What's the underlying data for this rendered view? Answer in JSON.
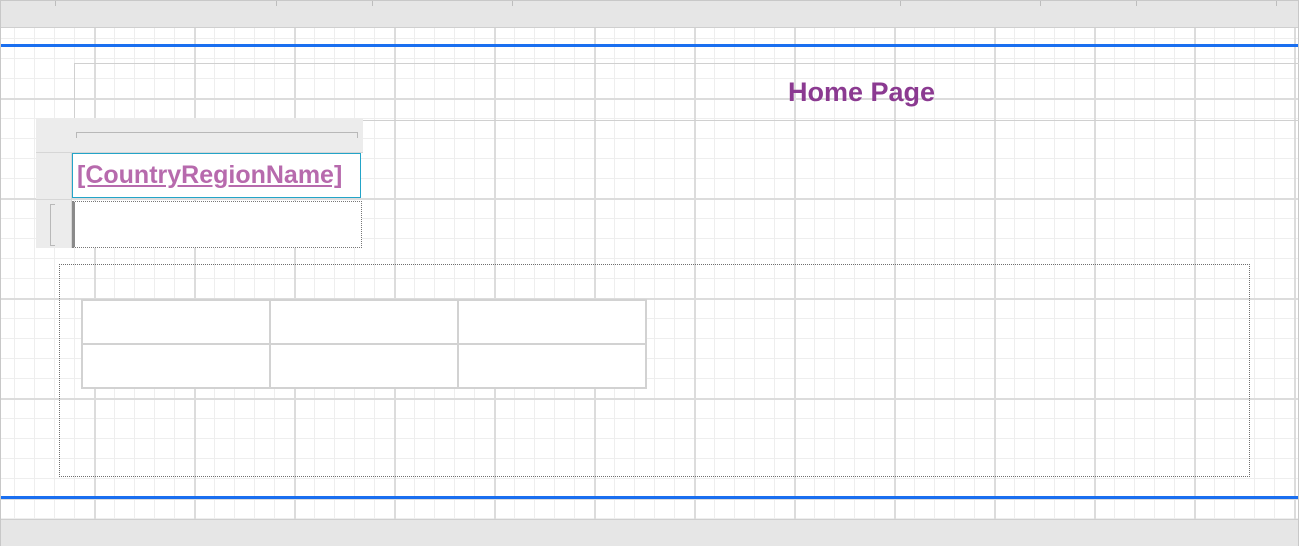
{
  "report": {
    "header": {
      "title": "Home Page"
    },
    "tablix": {
      "field_expression": "[CountryRegionName]"
    },
    "nested_table": {
      "rows": 2,
      "columns": 3
    }
  },
  "colors": {
    "band_line": "#1a6ff0",
    "title_text": "#8b3a91",
    "field_text": "#b76aad",
    "selected_cell_border": "#23a4c8"
  }
}
